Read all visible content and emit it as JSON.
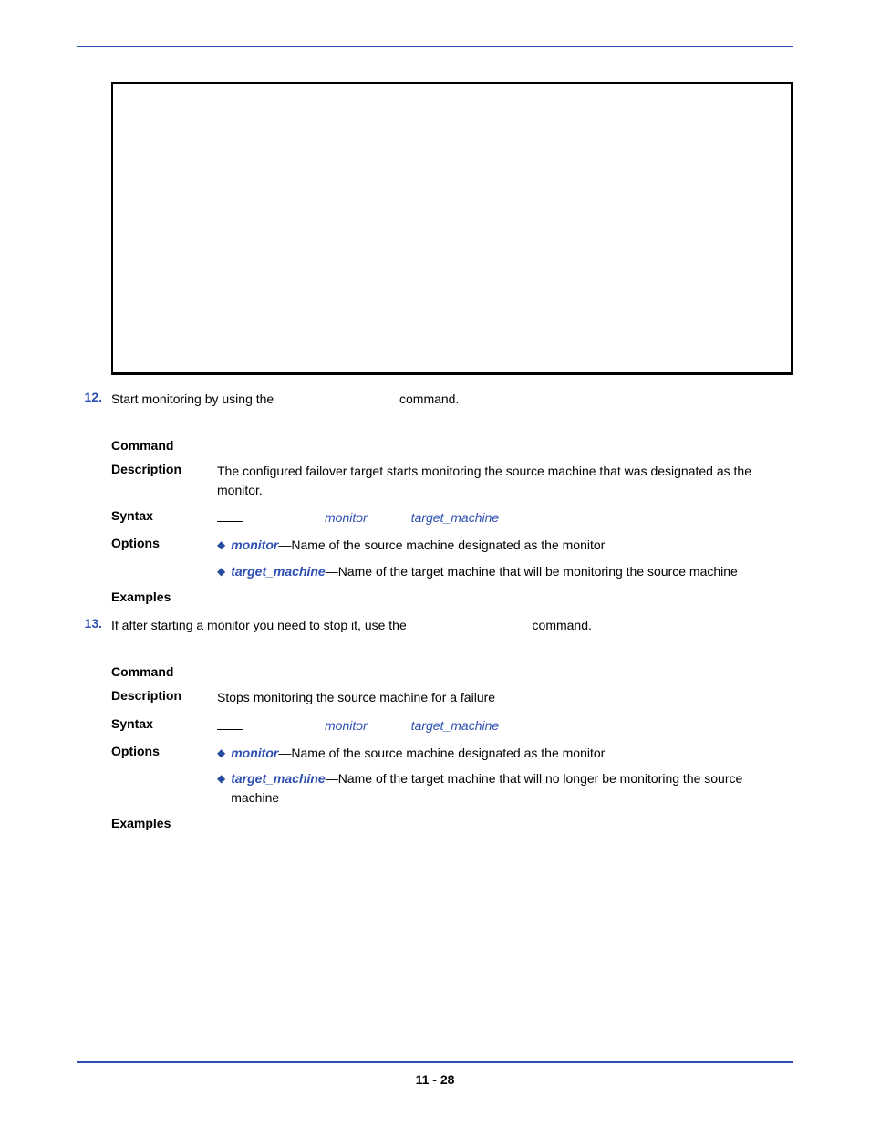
{
  "steps": {
    "s12": {
      "num": "12.",
      "text_before": "Start monitoring by using the",
      "text_after": "command."
    },
    "s13": {
      "num": "13.",
      "text_before": "If after starting a monitor you need to stop it, use the",
      "text_after": "command."
    }
  },
  "tables": {
    "t1": {
      "labels": {
        "command": "Command",
        "description": "Description",
        "syntax": "Syntax",
        "options": "Options",
        "examples": "Examples"
      },
      "description": "The configured failover target starts monitoring the source machine that was designated as the monitor.",
      "syntax": {
        "arg1": "monitor",
        "arg2": "target_machine"
      },
      "options": [
        {
          "var": "monitor",
          "desc": "—Name of the source machine designated as the monitor"
        },
        {
          "var": "target_machine",
          "desc": "—Name of the target machine that will be monitoring the source machine"
        }
      ]
    },
    "t2": {
      "labels": {
        "command": "Command",
        "description": "Description",
        "syntax": "Syntax",
        "options": "Options",
        "examples": "Examples"
      },
      "description": "Stops monitoring the source machine for a failure",
      "syntax": {
        "arg1": "monitor",
        "arg2": "target_machine"
      },
      "options": [
        {
          "var": "monitor",
          "desc": "—Name of the source machine designated as the monitor"
        },
        {
          "var": "target_machine",
          "desc": "—Name of the target machine that will no longer be monitoring the source machine"
        }
      ]
    }
  },
  "footer": {
    "page": "11 - 28"
  }
}
